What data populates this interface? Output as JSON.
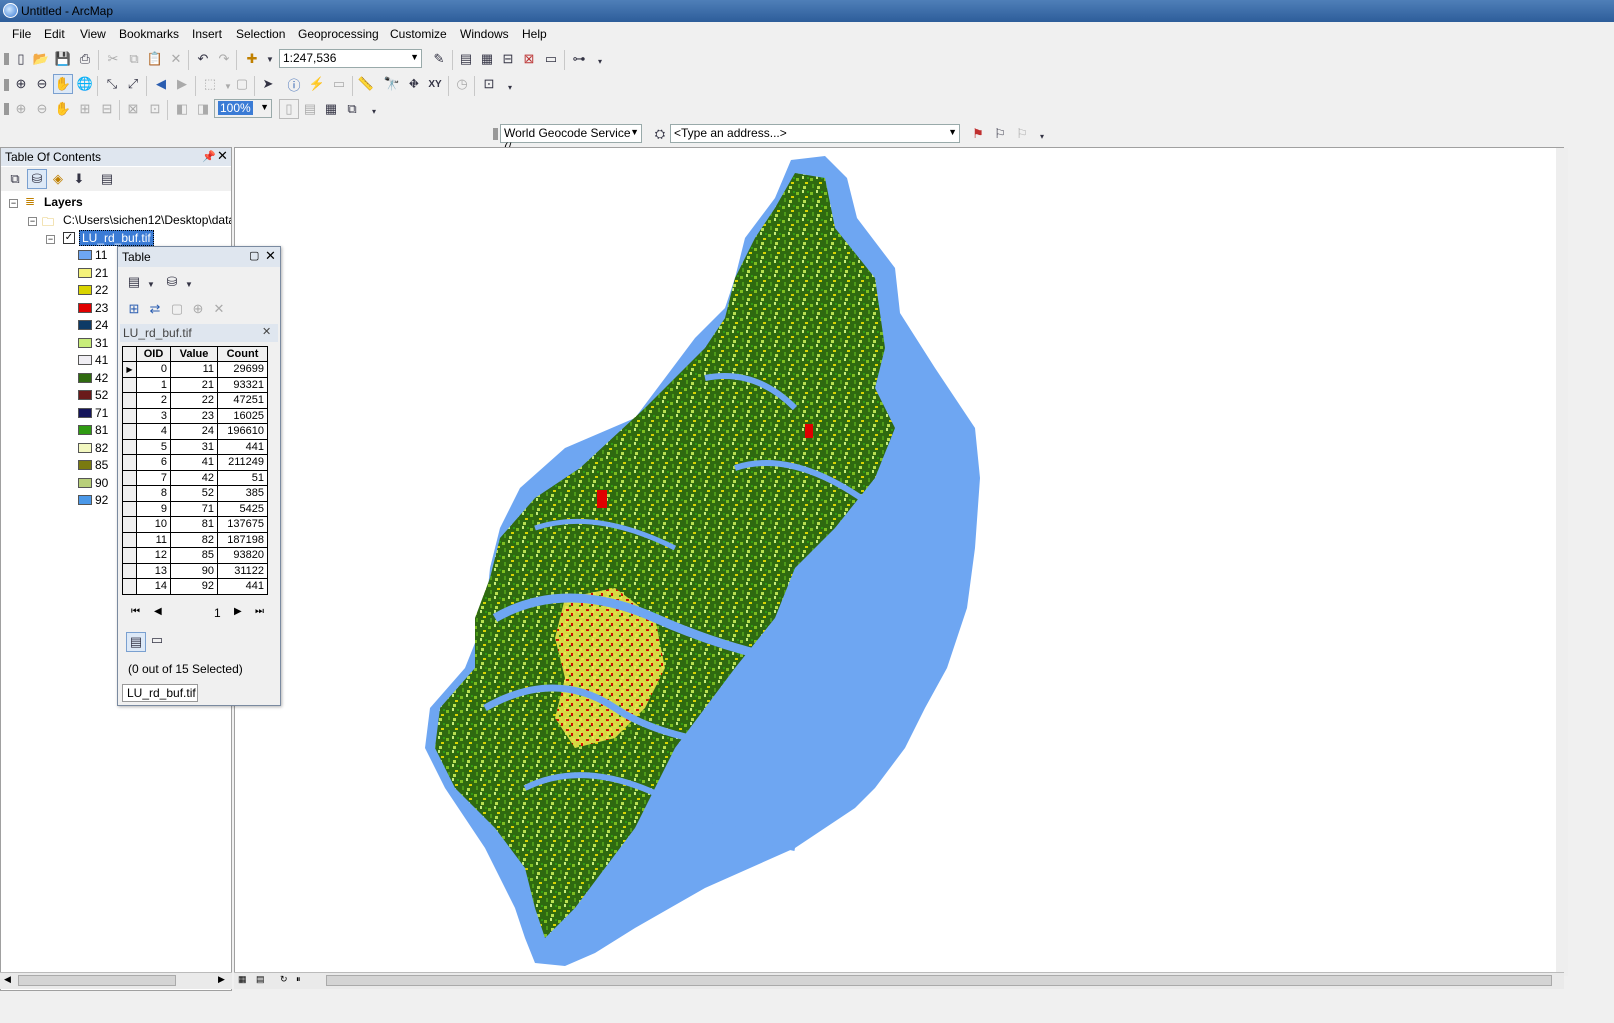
{
  "window": {
    "title": "Untitled - ArcMap"
  },
  "menu": [
    "File",
    "Edit",
    "View",
    "Bookmarks",
    "Insert",
    "Selection",
    "Geoprocessing",
    "Customize",
    "Windows",
    "Help"
  ],
  "toolbar": {
    "scale": "1:247,536",
    "zoom_percent": "100%",
    "geocode_service": "World Geocode Service (/",
    "address_placeholder": "<Type an address...>"
  },
  "toc": {
    "title": "Table Of Contents",
    "layers_label": "Layers",
    "folder_path": "C:\\Users\\sichen12\\Desktop\\data",
    "layer_name": "LU_rd_buf.tif",
    "legend": [
      {
        "label": "11",
        "color": "#6ea6f2"
      },
      {
        "label": "21",
        "color": "#f4f27a"
      },
      {
        "label": "22",
        "color": "#d9d400"
      },
      {
        "label": "23",
        "color": "#e00000"
      },
      {
        "label": "24",
        "color": "#0d3a66"
      },
      {
        "label": "31",
        "color": "#c8ec7a"
      },
      {
        "label": "41",
        "color": "#f0eef4"
      },
      {
        "label": "42",
        "color": "#2f6a10"
      },
      {
        "label": "52",
        "color": "#6a1a1a"
      },
      {
        "label": "71",
        "color": "#14145a"
      },
      {
        "label": "81",
        "color": "#2f9a12"
      },
      {
        "label": "82",
        "color": "#f3f8c0"
      },
      {
        "label": "85",
        "color": "#7a7a10"
      },
      {
        "label": "90",
        "color": "#b8cf7a"
      },
      {
        "label": "92",
        "color": "#4a98e8"
      }
    ]
  },
  "table": {
    "window_title": "Table",
    "tab_header": "LU_rd_buf.tif",
    "columns": [
      "OID",
      "Value",
      "Count"
    ],
    "rows": [
      [
        "0",
        "11",
        "29699"
      ],
      [
        "1",
        "21",
        "93321"
      ],
      [
        "2",
        "22",
        "47251"
      ],
      [
        "3",
        "23",
        "16025"
      ],
      [
        "4",
        "24",
        "196610"
      ],
      [
        "5",
        "31",
        "441"
      ],
      [
        "6",
        "41",
        "211249"
      ],
      [
        "7",
        "42",
        "51"
      ],
      [
        "8",
        "52",
        "385"
      ],
      [
        "9",
        "71",
        "5425"
      ],
      [
        "10",
        "81",
        "137675"
      ],
      [
        "11",
        "82",
        "187198"
      ],
      [
        "12",
        "85",
        "93820"
      ],
      [
        "13",
        "90",
        "31122"
      ],
      [
        "14",
        "92",
        "441"
      ]
    ],
    "current_record": "1",
    "status": "(0 out of 15 Selected)",
    "bottom_tab": "LU_rd_buf.tif"
  },
  "icons": {
    "title_icon": "arcmap-globe-icon",
    "colors": {
      "water": "#6ea6f2",
      "forest": "#2f6a10",
      "crop": "#2f9a12",
      "urban": "#e00000",
      "pasture": "#d9d400",
      "title_bar": "#3a6aa8"
    }
  }
}
